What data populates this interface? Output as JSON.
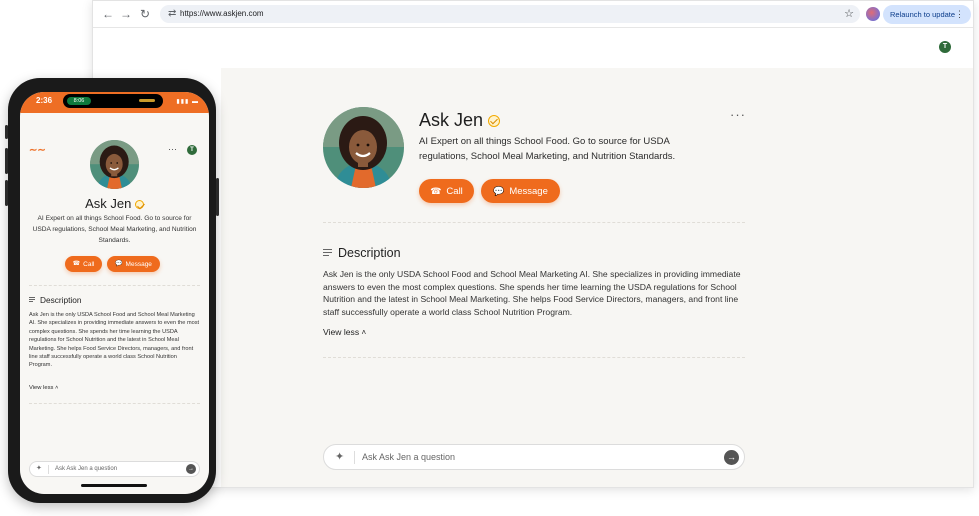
{
  "browser": {
    "url": "https://www.askjen.com",
    "relaunch_label": "Relaunch to update",
    "user_initial": "T"
  },
  "profile": {
    "name": "Ask Jen",
    "tagline": "AI Expert on all things School Food. Go to source for USDA regulations, School Meal Marketing, and Nutrition Standards.",
    "call_label": "Call",
    "message_label": "Message"
  },
  "description": {
    "heading": "Description",
    "body": "Ask Jen is the only USDA School Food and School Meal Marketing AI. She specializes in providing immediate answers to even the most complex questions. She spends her time learning the USDA regulations for School Nutrition and the latest in School Meal Marketing. She helps Food Service Directors, managers, and front line staff successfully operate a world class School Nutrition Program.",
    "toggle_label": "View less"
  },
  "chat": {
    "placeholder": "Ask Ask Jen a question"
  },
  "phone": {
    "time": "2:36",
    "call_pill": "8:06",
    "user_initial": "T"
  },
  "colors": {
    "accent": "#ef6b1d",
    "background": "#f7f6f3",
    "avatar": "#2f6b3a"
  }
}
